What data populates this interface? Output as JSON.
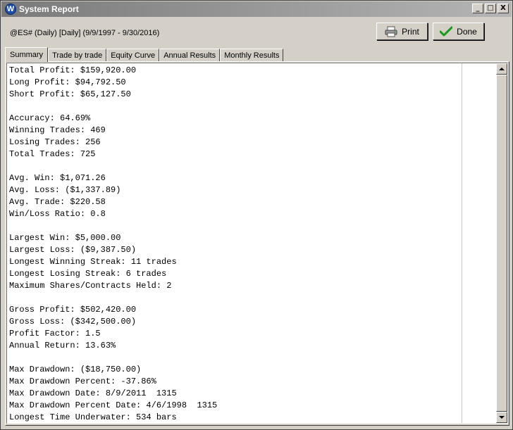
{
  "window": {
    "title": "System Report",
    "icon_letter": "W",
    "controls": {
      "minimize": "_",
      "maximize": "□",
      "close": "X"
    }
  },
  "header": {
    "symbol_info": "@ES# (Daily) [Daily]  (9/9/1997 - 9/30/2016)"
  },
  "toolbar": {
    "print_label": "Print",
    "done_label": "Done"
  },
  "tabs": [
    {
      "label": "Summary",
      "active": true
    },
    {
      "label": "Trade by trade",
      "active": false
    },
    {
      "label": "Equity Curve",
      "active": false
    },
    {
      "label": "Annual Results",
      "active": false
    },
    {
      "label": "Monthly Results",
      "active": false
    }
  ],
  "report_lines": [
    "Total Profit: $159,920.00",
    "Long Profit: $94,792.50",
    "Short Profit: $65,127.50",
    "",
    "Accuracy: 64.69%",
    "Winning Trades: 469",
    "Losing Trades: 256",
    "Total Trades: 725",
    "",
    "Avg. Win: $1,071.26",
    "Avg. Loss: ($1,337.89)",
    "Avg. Trade: $220.58",
    "Win/Loss Ratio: 0.8",
    "",
    "Largest Win: $5,000.00",
    "Largest Loss: ($9,387.50)",
    "Longest Winning Streak: 11 trades",
    "Longest Losing Streak: 6 trades",
    "Maximum Shares/Contracts Held: 2",
    "",
    "Gross Profit: $502,420.00",
    "Gross Loss: ($342,500.00)",
    "Profit Factor: 1.5",
    "Annual Return: 13.63%",
    "",
    "Max Drawdown: ($18,750.00)",
    "Max Drawdown Percent: -37.86%",
    "Max Drawdown Date: 8/9/2011  1315",
    "Max Drawdown Percent Date: 4/6/1998  1315",
    "Longest Time Underwater: 534 bars"
  ],
  "colors": {
    "done_check": "#1a9a1a",
    "title_icon": "#1c4fa8"
  }
}
